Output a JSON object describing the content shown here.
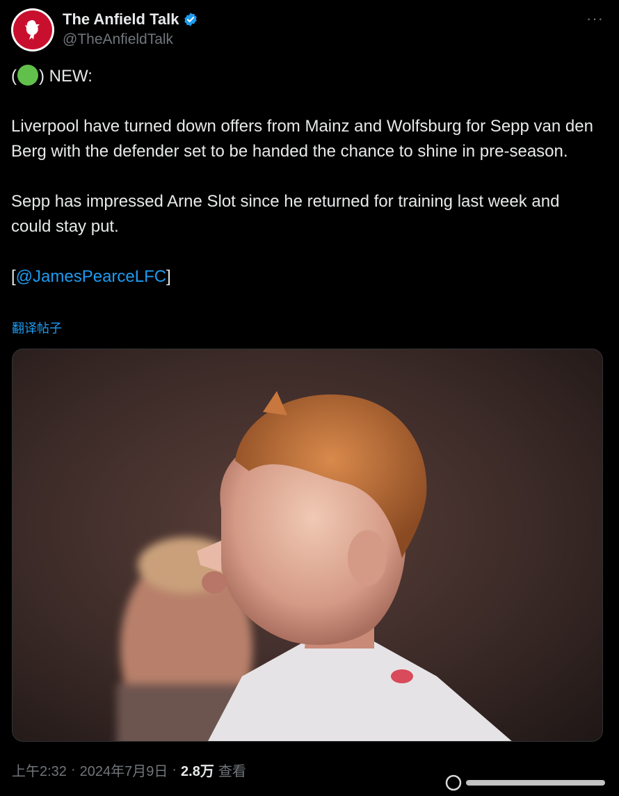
{
  "author": {
    "display_name": "The Anfield Talk",
    "handle": "@TheAnfieldTalk",
    "avatar_icon": "liverbird-logo-icon",
    "verified_icon": "verified-badge-icon",
    "more_label": "···"
  },
  "tweet": {
    "line1_prefix": "(",
    "line1_suffix": ") NEW:",
    "paragraph2": "Liverpool have turned down offers from Mainz and Wolfsburg for Sepp van den Berg with the defender set to be handed the chance to shine in pre-season.",
    "paragraph3": "Sepp has impressed Arne Slot since he returned for training last week and could stay put.",
    "mention_open": "[",
    "mention": "@JamesPearceLFC",
    "mention_close": "]",
    "translate_label": "翻译帖子"
  },
  "media": {
    "description_icon": "player-photo-image"
  },
  "meta": {
    "time": "上午2:32",
    "date": "2024年7月9日",
    "views_count": "2.8万",
    "views_label": "查看",
    "separator": "·"
  },
  "colors": {
    "background": "#000000",
    "text": "#e7e9ea",
    "muted": "#71767b",
    "accent": "#1d9bf0",
    "status_dot": "#61c04b"
  }
}
